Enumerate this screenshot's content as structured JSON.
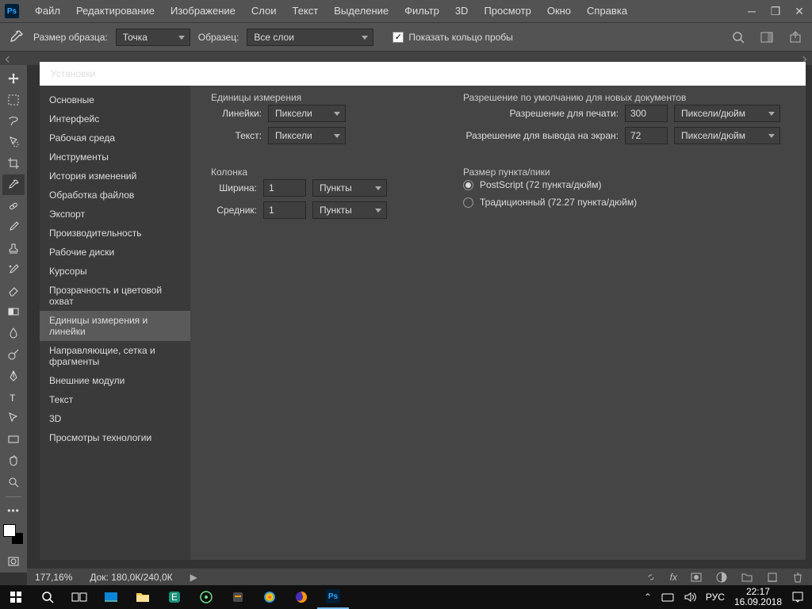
{
  "menu": [
    "Файл",
    "Редактирование",
    "Изображение",
    "Слои",
    "Текст",
    "Выделение",
    "Фильтр",
    "3D",
    "Просмотр",
    "Окно",
    "Справка"
  ],
  "options": {
    "sample_label": "Размер образца:",
    "sample_value": "Точка",
    "layers_label": "Образец:",
    "layers_value": "Все слои",
    "show_ring": "Показать кольцо пробы"
  },
  "dialog": {
    "title": "Установки",
    "side": [
      "Основные",
      "Интерфейс",
      "Рабочая среда",
      "Инструменты",
      "История изменений",
      "Обработка файлов",
      "Экспорт",
      "Производительность",
      "Рабочие диски",
      "Курсоры",
      "Прозрачность и цветовой охват",
      "Единицы измерения и линейки",
      "Направляющие, сетка и фрагменты",
      "Внешние модули",
      "Текст",
      "3D",
      "Просмотры технологии"
    ],
    "side_selected": 11,
    "groups": {
      "units": {
        "title": "Единицы измерения",
        "rulers_label": "Линейки:",
        "rulers_value": "Пиксели",
        "text_label": "Текст:",
        "text_value": "Пиксели"
      },
      "column": {
        "title": "Колонка",
        "width_label": "Ширина:",
        "width_value": "1",
        "width_unit": "Пункты",
        "gutter_label": "Средник:",
        "gutter_value": "1",
        "gutter_unit": "Пункты"
      },
      "resolution": {
        "title": "Разрешение по умолчанию для новых документов",
        "print_label": "Разрешение для печати:",
        "print_value": "300",
        "print_unit": "Пиксели/дюйм",
        "screen_label": "Разрешение для вывода на экран:",
        "screen_value": "72",
        "screen_unit": "Пиксели/дюйм"
      },
      "point": {
        "title": "Размер пункта/пики",
        "postscript": "PostScript (72 пункта/дюйм)",
        "traditional": "Традиционный (72.27 пункта/дюйм)"
      }
    }
  },
  "status": {
    "zoom": "177,16%",
    "doc": "Док: 180,0К/240,0К"
  },
  "tray": {
    "lang": "РУС",
    "time": "22:17",
    "date": "16.09.2018"
  },
  "tools": [
    "move-tool",
    "marquee-tool",
    "lasso-tool",
    "quick-select-tool",
    "crop-tool",
    "eyedropper-tool",
    "spot-heal-tool",
    "brush-tool",
    "stamp-tool",
    "history-brush-tool",
    "eraser-tool",
    "gradient-tool",
    "blur-tool",
    "dodge-tool",
    "pen-tool",
    "type-tool",
    "path-select-tool",
    "rectangle-tool",
    "hand-tool",
    "zoom-tool"
  ]
}
